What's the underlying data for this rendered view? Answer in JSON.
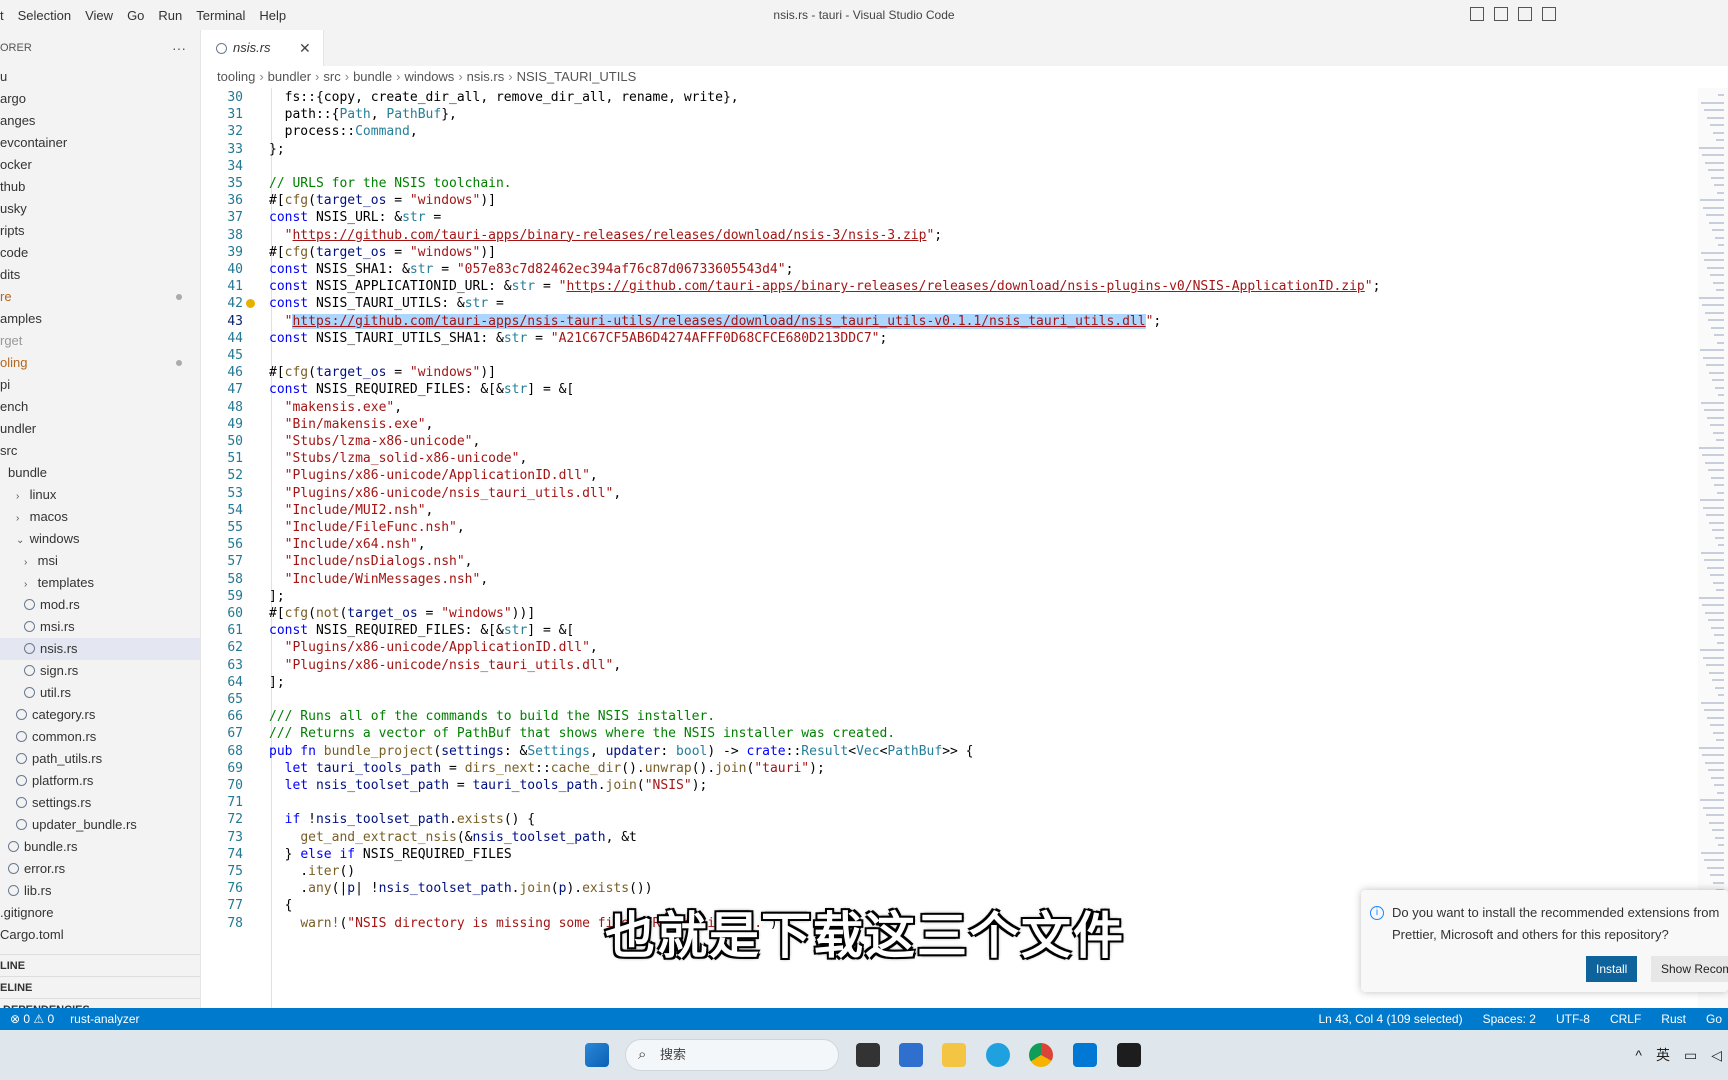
{
  "window": {
    "title": "nsis.rs - tauri - Visual Studio Code"
  },
  "menu": [
    "t",
    "Selection",
    "View",
    "Go",
    "Run",
    "Terminal",
    "Help"
  ],
  "sidebar": {
    "header": "ORER",
    "more": "···",
    "items": [
      {
        "label": "u",
        "indent": 0,
        "type": "folder"
      },
      {
        "label": "argo",
        "indent": 0,
        "type": "folder"
      },
      {
        "label": "anges",
        "indent": 0,
        "type": "folder"
      },
      {
        "label": "evcontainer",
        "indent": 0,
        "type": "folder"
      },
      {
        "label": "ocker",
        "indent": 0,
        "type": "folder"
      },
      {
        "label": "thub",
        "indent": 0,
        "type": "folder"
      },
      {
        "label": "usky",
        "indent": 0,
        "type": "folder"
      },
      {
        "label": "ripts",
        "indent": 0,
        "type": "folder"
      },
      {
        "label": "code",
        "indent": 0,
        "type": "folder"
      },
      {
        "label": "dits",
        "indent": 0,
        "type": "folder"
      },
      {
        "label": "re",
        "indent": 0,
        "type": "folder",
        "modified": true,
        "color": "#b5651d"
      },
      {
        "label": "amples",
        "indent": 0,
        "type": "folder"
      },
      {
        "label": "rget",
        "indent": 0,
        "type": "folder",
        "color": "#999999"
      },
      {
        "label": "oling",
        "indent": 0,
        "type": "folder",
        "modified": true,
        "color": "#b5651d"
      },
      {
        "label": "pi",
        "indent": 0,
        "type": "folder"
      },
      {
        "label": "ench",
        "indent": 0,
        "type": "folder"
      },
      {
        "label": "undler",
        "indent": 0,
        "type": "folder"
      },
      {
        "label": "src",
        "indent": 0,
        "type": "folder"
      },
      {
        "label": "bundle",
        "indent": 1,
        "type": "folder"
      },
      {
        "label": "linux",
        "indent": 2,
        "type": "folder",
        "chev": "›"
      },
      {
        "label": "macos",
        "indent": 2,
        "type": "folder",
        "chev": "›"
      },
      {
        "label": "windows",
        "indent": 2,
        "type": "folder",
        "chev": "⌄"
      },
      {
        "label": "msi",
        "indent": 3,
        "type": "folder",
        "chev": "›"
      },
      {
        "label": "templates",
        "indent": 3,
        "type": "folder",
        "chev": "›"
      },
      {
        "label": "mod.rs",
        "indent": 3,
        "type": "file"
      },
      {
        "label": "msi.rs",
        "indent": 3,
        "type": "file"
      },
      {
        "label": "nsis.rs",
        "indent": 3,
        "type": "file",
        "selected": true
      },
      {
        "label": "sign.rs",
        "indent": 3,
        "type": "file"
      },
      {
        "label": "util.rs",
        "indent": 3,
        "type": "file"
      },
      {
        "label": "category.rs",
        "indent": 2,
        "type": "file"
      },
      {
        "label": "common.rs",
        "indent": 2,
        "type": "file"
      },
      {
        "label": "path_utils.rs",
        "indent": 2,
        "type": "file"
      },
      {
        "label": "platform.rs",
        "indent": 2,
        "type": "file"
      },
      {
        "label": "settings.rs",
        "indent": 2,
        "type": "file"
      },
      {
        "label": "updater_bundle.rs",
        "indent": 2,
        "type": "file"
      },
      {
        "label": "bundle.rs",
        "indent": 1,
        "type": "file"
      },
      {
        "label": "error.rs",
        "indent": 1,
        "type": "file"
      },
      {
        "label": "lib.rs",
        "indent": 1,
        "type": "file"
      },
      {
        "label": ".gitignore",
        "indent": 0,
        "type": "file"
      },
      {
        "label": "Cargo.toml",
        "indent": 0,
        "type": "file"
      }
    ],
    "sections": [
      "LINE",
      "ELINE",
      "DEPENDENCIES"
    ]
  },
  "tab": {
    "name": "nsis.rs",
    "close": "✕"
  },
  "breadcrumb": [
    "tooling",
    "bundler",
    "src",
    "bundle",
    "windows",
    "nsis.rs",
    "NSIS_TAURI_UTILS"
  ],
  "editor": {
    "active_line": 43,
    "lines": [
      {
        "n": 30,
        "html": "  fs::{copy, create_dir_all, remove_dir_all, rename, write},"
      },
      {
        "n": 31,
        "html": "  path::{<span class='t'>Path</span>, <span class='t'>PathBuf</span>},"
      },
      {
        "n": 32,
        "html": "  process::<span class='t'>Command</span>,"
      },
      {
        "n": 33,
        "html": "};"
      },
      {
        "n": 34,
        "html": ""
      },
      {
        "n": 35,
        "html": "<span class='c'>// URLS for the NSIS toolchain.</span>"
      },
      {
        "n": 36,
        "html": "#[<span class='f'>cfg</span>(<span class='v'>target_os</span> = <span class='s'>\"windows\"</span>)]"
      },
      {
        "n": 37,
        "html": "<span class='k'>const</span> NSIS_URL: &amp;<span class='t'>str</span> ="
      },
      {
        "n": 38,
        "html": "  <span class='s'>\"</span><span class='u'>https://github.com/tauri-apps/binary-releases/releases/download/nsis-3/nsis-3.zip</span><span class='s'>\"</span>;"
      },
      {
        "n": 39,
        "html": "#[<span class='f'>cfg</span>(<span class='v'>target_os</span> = <span class='s'>\"windows\"</span>)]"
      },
      {
        "n": 40,
        "html": "<span class='k'>const</span> NSIS_SHA1: &amp;<span class='t'>str</span> = <span class='s'>\"057e83c7d82462ec394af76c87d06733605543d4\"</span>;"
      },
      {
        "n": 41,
        "html": "<span class='k'>const</span> NSIS_APPLICATIONID_URL: &amp;<span class='t'>str</span> = <span class='s'>\"</span><span class='u'>https://github.com/tauri-apps/binary-releases/releases/download/nsis-plugins-v0/NSIS-ApplicationID.zip</span><span class='s'>\"</span>;"
      },
      {
        "n": 42,
        "html": "<span class='k'>const</span> NSIS_TAURI_UTILS: &amp;<span class='t'>str</span> ="
      },
      {
        "n": 43,
        "html": "  <span class='s'>\"</span><span class='sel'><span class='u'>https://github.com/tauri-apps/nsis-tauri-utils/releases/download/nsis_tauri_utils-v0.1.1/nsis_tauri_utils.dll</span></span><span class='s'>\"</span>;"
      },
      {
        "n": 44,
        "html": "<span class='k'>const</span> NSIS_TAURI_UTILS_SHA1: &amp;<span class='t'>str</span> = <span class='s'>\"A21C67CF5AB6D4274AFFF0D68CFCE680D213DDC7\"</span>;"
      },
      {
        "n": 45,
        "html": ""
      },
      {
        "n": 46,
        "html": "#[<span class='f'>cfg</span>(<span class='v'>target_os</span> = <span class='s'>\"windows\"</span>)]"
      },
      {
        "n": 47,
        "html": "<span class='k'>const</span> NSIS_REQUIRED_FILES: &amp;[&amp;<span class='t'>str</span>] = &amp;["
      },
      {
        "n": 48,
        "html": "  <span class='s'>\"makensis.exe\"</span>,"
      },
      {
        "n": 49,
        "html": "  <span class='s'>\"Bin/makensis.exe\"</span>,"
      },
      {
        "n": 50,
        "html": "  <span class='s'>\"Stubs/lzma-x86-unicode\"</span>,"
      },
      {
        "n": 51,
        "html": "  <span class='s'>\"Stubs/lzma_solid-x86-unicode\"</span>,"
      },
      {
        "n": 52,
        "html": "  <span class='s'>\"Plugins/x86-unicode/ApplicationID.dll\"</span>,"
      },
      {
        "n": 53,
        "html": "  <span class='s'>\"Plugins/x86-unicode/nsis_tauri_utils.dll\"</span>,"
      },
      {
        "n": 54,
        "html": "  <span class='s'>\"Include/MUI2.nsh\"</span>,"
      },
      {
        "n": 55,
        "html": "  <span class='s'>\"Include/FileFunc.nsh\"</span>,"
      },
      {
        "n": 56,
        "html": "  <span class='s'>\"Include/x64.nsh\"</span>,"
      },
      {
        "n": 57,
        "html": "  <span class='s'>\"Include/nsDialogs.nsh\"</span>,"
      },
      {
        "n": 58,
        "html": "  <span class='s'>\"Include/WinMessages.nsh\"</span>,"
      },
      {
        "n": 59,
        "html": "];"
      },
      {
        "n": 60,
        "html": "#[<span class='f'>cfg</span>(<span class='f'>not</span>(<span class='v'>target_os</span> = <span class='s'>\"windows\"</span>))]"
      },
      {
        "n": 61,
        "html": "<span class='k'>const</span> NSIS_REQUIRED_FILES: &amp;[&amp;<span class='t'>str</span>] = &amp;["
      },
      {
        "n": 62,
        "html": "  <span class='s'>\"Plugins/x86-unicode/ApplicationID.dll\"</span>,"
      },
      {
        "n": 63,
        "html": "  <span class='s'>\"Plugins/x86-unicode/nsis_tauri_utils.dll\"</span>,"
      },
      {
        "n": 64,
        "html": "];"
      },
      {
        "n": 65,
        "html": ""
      },
      {
        "n": 66,
        "html": "<span class='c'>/// Runs all of the commands to build the NSIS installer.</span>"
      },
      {
        "n": 67,
        "html": "<span class='c'>/// Returns a vector of PathBuf that shows where the NSIS installer was created.</span>"
      },
      {
        "n": 68,
        "html": "<span class='k'>pub fn</span> <span class='f'>bundle_project</span>(<span class='v'>settings</span>: &amp;<span class='t'>Settings</span>, <span class='v'>updater</span>: <span class='t'>bool</span>) -&gt; <span class='k'>crate</span>::<span class='t'>Result</span>&lt;<span class='t'>Vec</span>&lt;<span class='t'>PathBuf</span>&gt;&gt; {"
      },
      {
        "n": 69,
        "html": "  <span class='k'>let</span> <span class='v'>tauri_tools_path</span> = <span class='f'>dirs_next</span>::<span class='f'>cache_dir</span>().<span class='f'>unwrap</span>().<span class='f'>join</span>(<span class='s'>\"tauri\"</span>);"
      },
      {
        "n": 70,
        "html": "  <span class='k'>let</span> <span class='v'>nsis_toolset_path</span> = <span class='v'>tauri_tools_path</span>.<span class='f'>join</span>(<span class='s'>\"NSIS\"</span>);"
      },
      {
        "n": 71,
        "html": ""
      },
      {
        "n": 72,
        "html": "  <span class='k'>if</span> !<span class='v'>nsis_toolset_path</span>.<span class='f'>exists</span>() {"
      },
      {
        "n": 73,
        "html": "    <span class='f'>get_and_extract_nsis</span>(&amp;<span class='v'>nsis_toolset_path</span>, &amp;t"
      },
      {
        "n": 74,
        "html": "  } <span class='k'>else if</span> NSIS_REQUIRED_FILES"
      },
      {
        "n": 75,
        "html": "    .<span class='f'>iter</span>()"
      },
      {
        "n": 76,
        "html": "    .<span class='f'>any</span>(|<span class='v'>p</span>| !<span class='v'>nsis_toolset_path</span>.<span class='f'>join</span>(<span class='v'>p</span>).<span class='f'>exists</span>())"
      },
      {
        "n": 77,
        "html": "  {"
      },
      {
        "n": 78,
        "html": "    <span class='f'>warn!</span>(<span class='s'>\"NSIS directory is missing some files. Recreating it.\"</span>);"
      }
    ]
  },
  "notification": {
    "message": "Do you want to install the recommended extensions from Prettier, Microsoft and others for this repository?",
    "install": "Install",
    "show": "Show Recom"
  },
  "subtitle": "也就是下载这三个文件",
  "status": {
    "left": [
      "⊗ 0 ⚠ 0",
      "rust-analyzer"
    ],
    "right": [
      "Ln 43, Col 4 (109 selected)",
      "Spaces: 2",
      "UTF-8",
      "CRLF",
      "Rust",
      "Go"
    ]
  },
  "taskbar": {
    "search_label": "搜索",
    "tray": [
      "^",
      "英"
    ],
    "colors": {
      "bar": "#dfe7ec",
      "accent": "#007acc"
    }
  }
}
